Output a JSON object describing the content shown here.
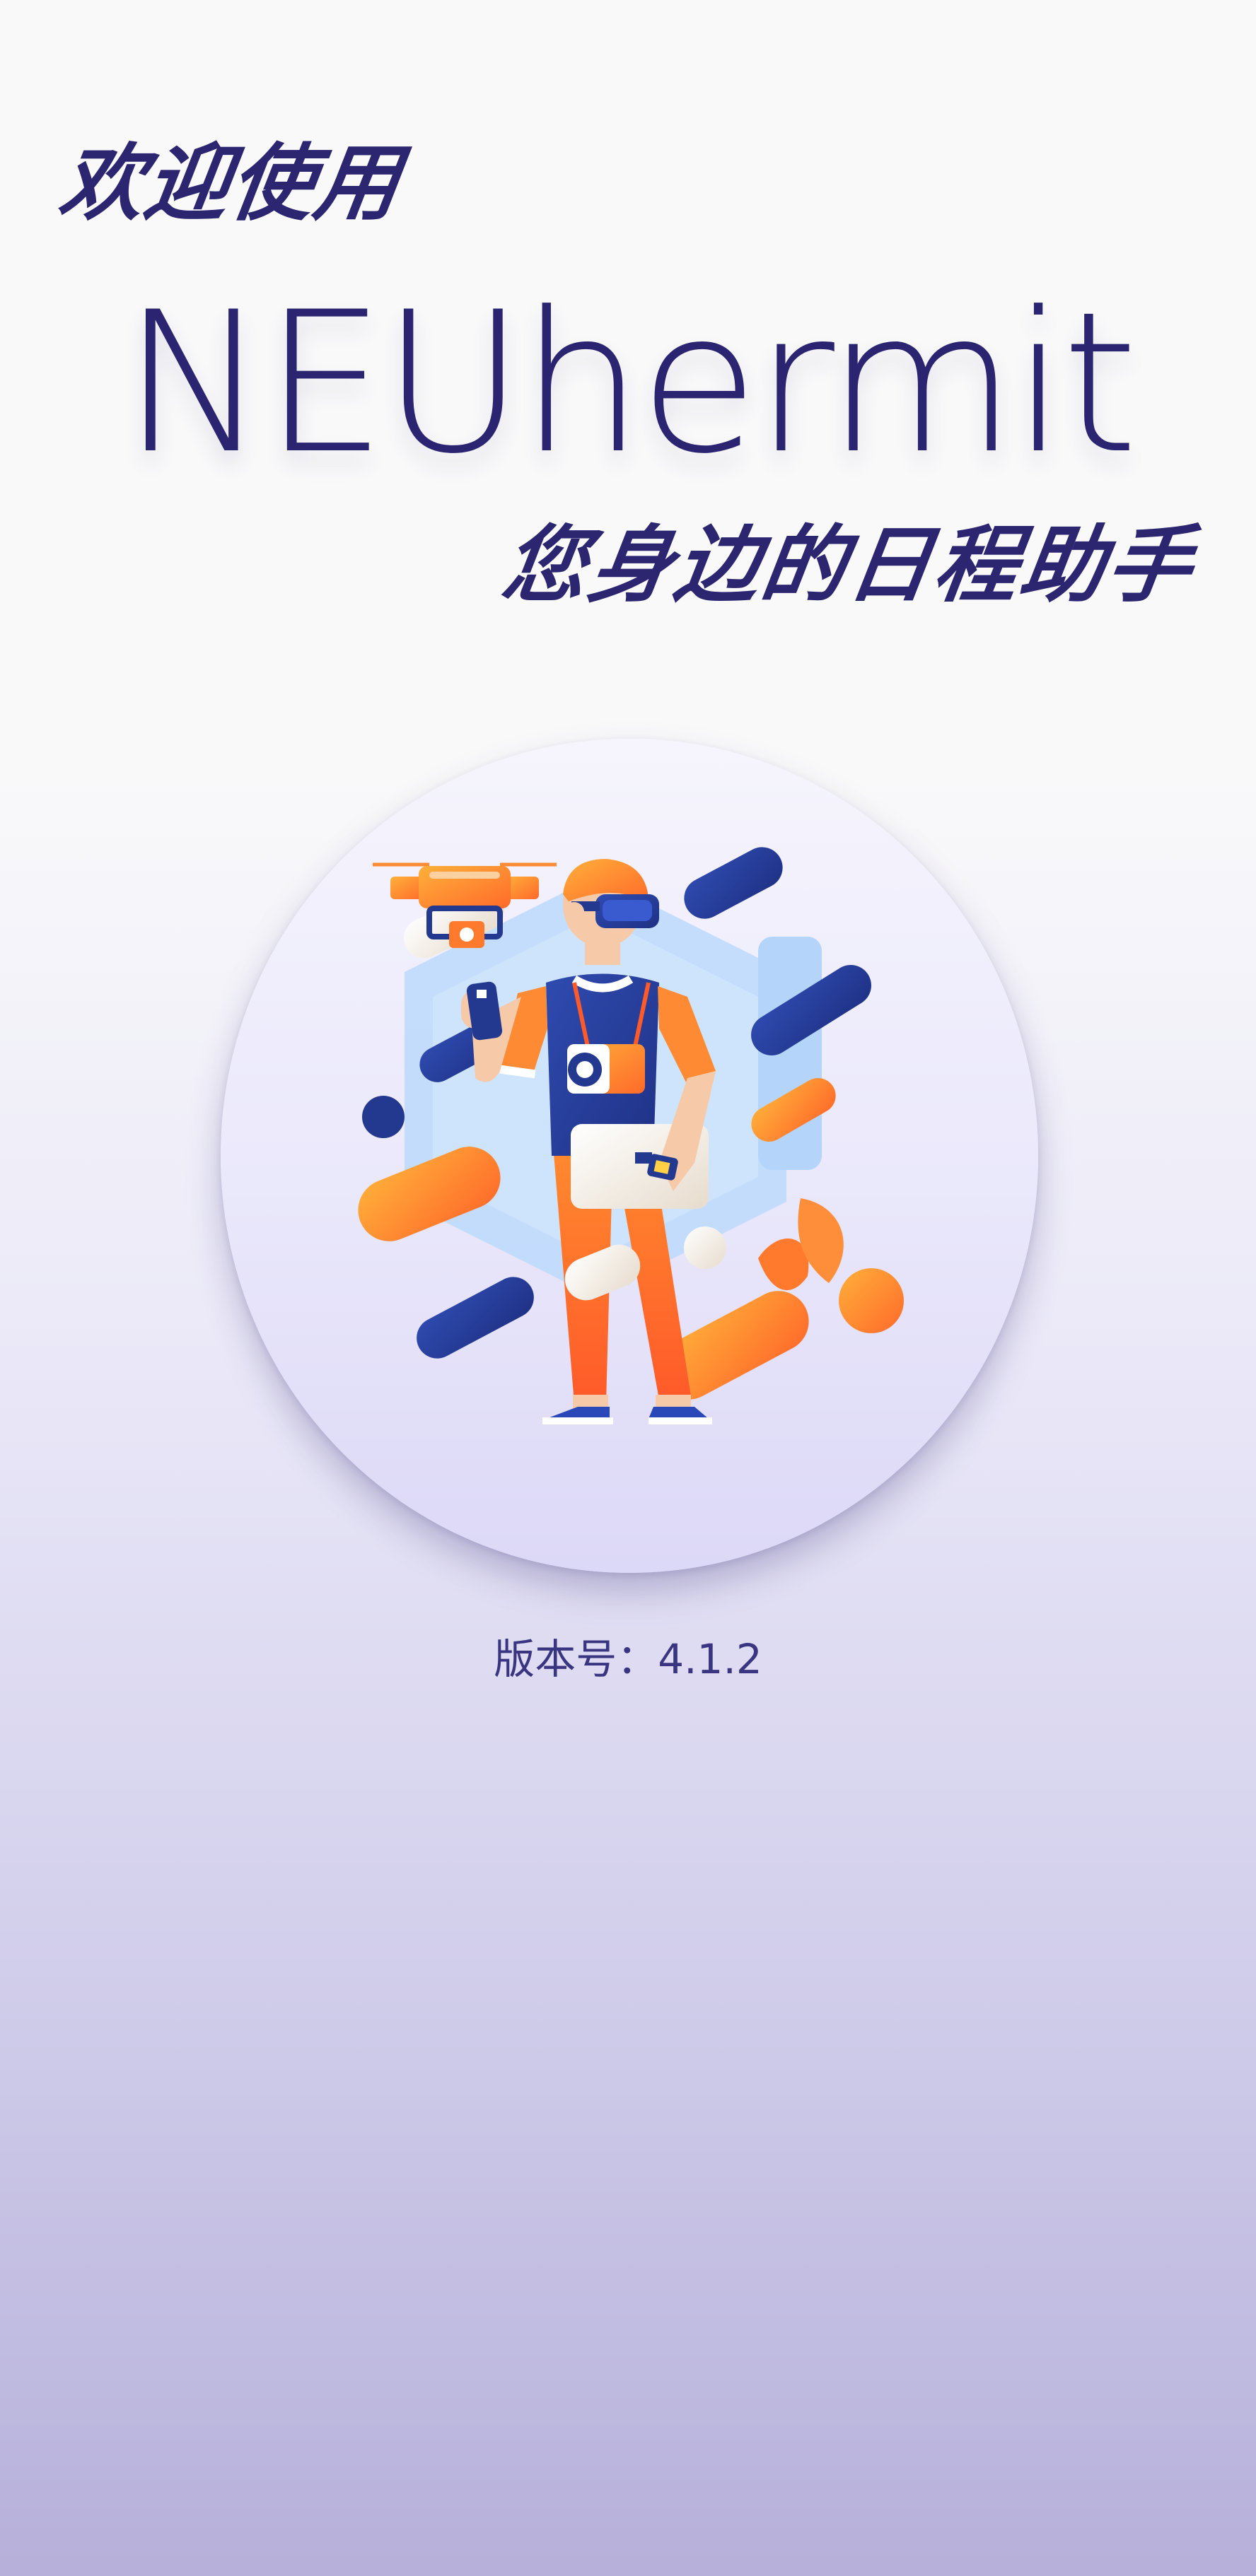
{
  "splash": {
    "welcome": "欢迎使用",
    "app_name": "NEUhermit",
    "tagline": "您身边的日程助手",
    "version_text": "版本号：4.1.2"
  },
  "illustration": {
    "icon": "person-with-drone-illustration",
    "colors": {
      "navy": "#23398f",
      "orange": "#ff8a34",
      "light_blue": "#b9d8fb",
      "cream": "#eee5d8",
      "text": "#2c2570"
    }
  }
}
